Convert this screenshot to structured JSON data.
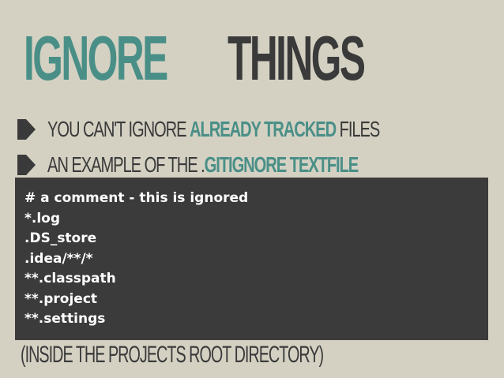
{
  "title": {
    "accent": "IGNORE",
    "rest": "THINGS"
  },
  "bullets": [
    {
      "icon": "bullet-arrow-icon",
      "before": "YOU CAN'T IGNORE ",
      "highlight": "ALREADY TRACKED",
      "after": " FILES"
    },
    {
      "icon": "bullet-arrow-icon",
      "before": "AN EXAMPLE OF THE .",
      "highlight": "GITIGNORE TEXTFILE",
      "after": ""
    }
  ],
  "code": {
    "lines": [
      "# a comment - this is ignored",
      "*.log",
      ".DS_store",
      ".idea/**/*",
      "**.classpath",
      "**.project",
      "**.settings"
    ]
  },
  "footer": {
    "note": "(INSIDE THE PROJECTS ROOT DIRECTORY)"
  },
  "colors": {
    "background": "#d4d1c3",
    "accent": "#4a8f87",
    "dark": "#3a3a3a",
    "code_background": "#3b3b3b",
    "code_text": "#ffffff"
  }
}
